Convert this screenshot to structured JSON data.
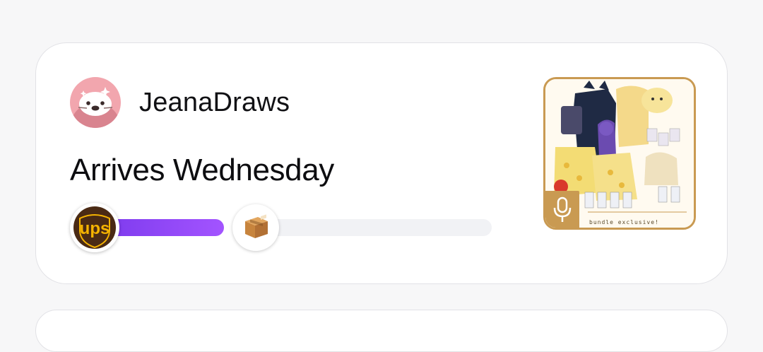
{
  "order": {
    "shop_name": "JeanaDraws",
    "status_title": "Arrives Wednesday",
    "carrier": "UPS",
    "carrier_logo_text": "ups",
    "progress": 0.35,
    "thumbnail_caption": "bundle exclusive!"
  },
  "icons": {
    "avatar": "otter-avatar",
    "carrier": "ups-logo-icon",
    "package": "package-box-icon",
    "mic": "microphone-icon"
  },
  "colors": {
    "accent": "#8b3cf7",
    "thumbnail_border": "#c99a52",
    "ups_brown": "#4a2a14",
    "ups_gold": "#f5b301"
  }
}
